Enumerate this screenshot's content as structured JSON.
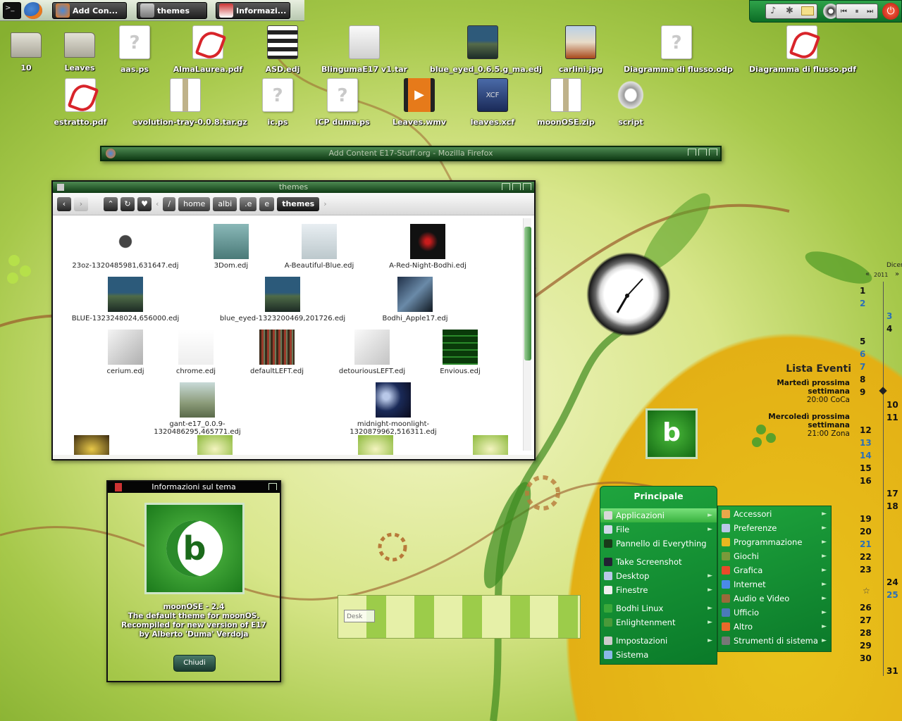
{
  "taskbar": {
    "items": [
      {
        "label": "Add  Con...",
        "icon": "firefox-icon"
      },
      {
        "label": "themes",
        "icon": "file-manager-icon"
      },
      {
        "label": "Informazi...",
        "icon": "theme-info-icon"
      }
    ]
  },
  "desktop_icons": [
    {
      "label": "10",
      "kind": "folder"
    },
    {
      "label": "Leaves",
      "kind": "folder"
    },
    {
      "label": "aas.ps",
      "kind": "unknown"
    },
    {
      "label": "AlmaLaurea.pdf",
      "kind": "pdf"
    },
    {
      "label": "ASD.edj",
      "kind": "edj"
    },
    {
      "label": "BlingumaE17 v1.tar",
      "kind": "archive"
    },
    {
      "label": "blue_eyed_0.6.5.g_ma.edj",
      "kind": "image"
    },
    {
      "label": "carlini.jpg",
      "kind": "image"
    },
    {
      "label": "Diagramma di flusso.odp",
      "kind": "unknown"
    },
    {
      "label": "Diagramma di flusso.pdf",
      "kind": "pdf"
    },
    {
      "label": "estratto.pdf",
      "kind": "pdf"
    },
    {
      "label": "evolution-tray-0.0.8.tar.gz",
      "kind": "zip"
    },
    {
      "label": "ic.ps",
      "kind": "unknown"
    },
    {
      "label": "ICP duma.ps",
      "kind": "unknown"
    },
    {
      "label": "Leaves.wmv",
      "kind": "video"
    },
    {
      "label": "leaves.xcf",
      "kind": "xcf"
    },
    {
      "label": "moonOSE.zip",
      "kind": "zip"
    },
    {
      "label": "script",
      "kind": "gear"
    }
  ],
  "firefox_window": {
    "title": "Add   Content E17-Stuff.org - Mozilla Firefox"
  },
  "themes_window": {
    "title": "themes",
    "breadcrumbs": [
      "/",
      "home",
      "albi",
      ".e",
      "e",
      "themes"
    ],
    "files": [
      "23oz-1320485981,631647.edj",
      "3Dom.edj",
      "A-Beautiful-Blue.edj",
      "A-Red-Night-Bodhi.edj",
      "BLUE-1323248024,656000.edj",
      "blue_eyed-1323200469,201726.edj",
      "Bodhi_Apple17.edj",
      "cerium.edj",
      "chrome.edj",
      "defaultLEFT.edj",
      "detouriousLEFT.edj",
      "Envious.edj",
      "gant-e17_0.0.9-1320486295,465771.edj",
      "midnight-moonlight-1320879962,516311.edj"
    ]
  },
  "info_window": {
    "title": "Informazioni sul tema",
    "lines": [
      "moonOSE - 2.4",
      "The default theme for moonOS.",
      "Recompiled for new version of E17",
      "by Alberto 'Duma' Verdoja"
    ],
    "close_label": "Chiudi"
  },
  "pager": {
    "label": "Desk"
  },
  "events": {
    "title": "Lista Eventi",
    "items": [
      {
        "day": "Martedì prossima settimana",
        "time": "20:00 CoCa"
      },
      {
        "day": "Mercoledì prossima settimana",
        "time": "21:00 Zona"
      }
    ]
  },
  "calendar": {
    "month": "Dicer",
    "year": "2011",
    "nav_prev": "«",
    "nav_next": "»",
    "days": [
      "1",
      "2",
      "3",
      "4",
      "5",
      "6",
      "7",
      "8",
      "9",
      "10",
      "11",
      "12",
      "13",
      "14",
      "15",
      "16",
      "17",
      "18",
      "19",
      "20",
      "21",
      "22",
      "23",
      "24",
      "25",
      "26",
      "27",
      "28",
      "29",
      "30",
      "31"
    ],
    "highlight": [
      "2",
      "3",
      "6",
      "7",
      "13",
      "14",
      "21",
      "25"
    ]
  },
  "main_menu": {
    "title": "Principale",
    "items": [
      "Applicazioni",
      "File",
      "Pannello di Everything",
      "Take Screenshot",
      "Desktop",
      "Finestre",
      "Bodhi Linux",
      "Enlightenment",
      "Impostazioni",
      "Sistema"
    ]
  },
  "sub_menu": {
    "items": [
      "Accessori",
      "Preferenze",
      "Programmazione",
      "Giochi",
      "Grafica",
      "Internet",
      "Audio e Video",
      "Ufficio",
      "Altro",
      "Strumenti di sistema"
    ]
  },
  "colors": {
    "menu_green": "#1fa53e",
    "titlebar_green": "#0f3b14",
    "calendar_blue": "#2a6fb8"
  }
}
